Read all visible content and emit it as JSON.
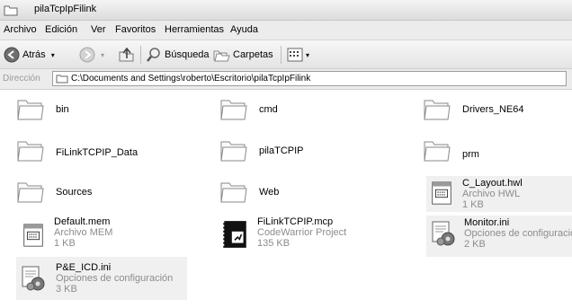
{
  "window": {
    "title": "pilaTcpIpFilink"
  },
  "menu": [
    "Archivo",
    "Edición",
    "Ver",
    "Favoritos",
    "Herramientas",
    "Ayuda"
  ],
  "toolbar": {
    "back": "Atrás",
    "search": "Búsqueda",
    "folders": "Carpetas"
  },
  "address": {
    "label": "Dirección",
    "path": "C:\\Documents and Settings\\roberto\\Escritorio\\pilaTcpIpFilink"
  },
  "items": [
    {
      "name": "bin",
      "icon": "folder-icon"
    },
    {
      "name": "cmd",
      "icon": "folder-icon"
    },
    {
      "name": "Drivers_NE64",
      "icon": "folder-icon"
    },
    {
      "name": "FiLinkTCPIP_Data",
      "icon": "folder-icon"
    },
    {
      "name": "pilaTCPIP",
      "icon": "folder-icon"
    },
    {
      "name": "prm",
      "icon": "folder-icon"
    },
    {
      "name": "Sources",
      "icon": "folder-icon"
    },
    {
      "name": "Web",
      "icon": "folder-icon"
    },
    {
      "name": "C_Layout.hwl",
      "type": "Archivo HWL",
      "size": "1 KB",
      "icon": "hwl-file-icon"
    },
    {
      "name": "Default.mem",
      "type": "Archivo MEM",
      "size": "1 KB",
      "icon": "mem-file-icon"
    },
    {
      "name": "FiLinkTCPIP.mcp",
      "type": "CodeWarrior Project",
      "size": "135 KB",
      "icon": "codewarrior-project-icon"
    },
    {
      "name": "Monitor.ini",
      "type": "Opciones de configuración",
      "size": "2 KB",
      "icon": "ini-file-icon"
    },
    {
      "name": "P&E_ICD.ini",
      "type": "Opciones de configuración",
      "size": "3 KB",
      "icon": "ini-file-icon"
    }
  ]
}
